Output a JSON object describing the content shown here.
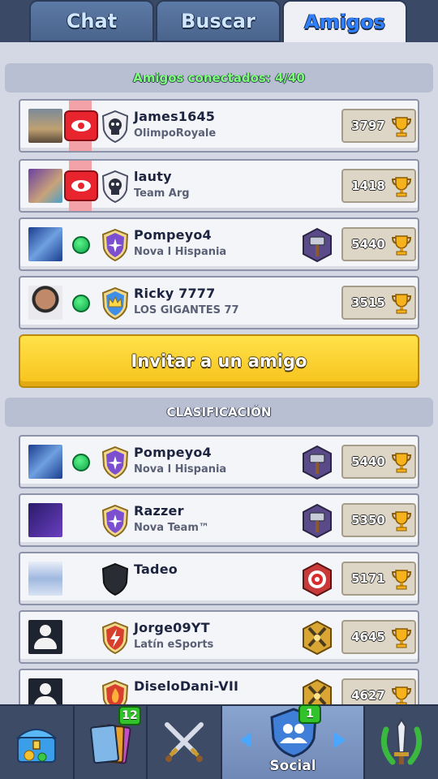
{
  "tabs": [
    {
      "label": "Chat"
    },
    {
      "label": "Buscar"
    },
    {
      "label": "Amigos"
    }
  ],
  "friends": {
    "header": "Amigos conectados: 4/40",
    "rows": [
      {
        "name": "James1645",
        "clan": "OlimpoRoyale",
        "trophies": "3797"
      },
      {
        "name": "lauty",
        "clan": "Team Arg",
        "trophies": "1418"
      },
      {
        "name": "Pompeyo4",
        "clan": "Nova l Hispania",
        "trophies": "5440"
      },
      {
        "name": "Ricky 7777",
        "clan": "LOS GIGANTES 77",
        "trophies": "3515"
      }
    ]
  },
  "invite_button": "Invitar a un amigo",
  "ranking": {
    "header": "CLASIFICACIÓN",
    "rows": [
      {
        "name": "Pompeyo4",
        "clan": "Nova l Hispania",
        "trophies": "5440"
      },
      {
        "name": "Razzer",
        "clan": "Nova Team™",
        "trophies": "5350"
      },
      {
        "name": "Tadeo",
        "clan": "",
        "trophies": "5171"
      },
      {
        "name": "Jorge09YT",
        "clan": "Latín eSports",
        "trophies": "4645"
      },
      {
        "name": "DiseloDani-VII",
        "clan": "",
        "trophies": "4627"
      }
    ]
  },
  "bottom_nav": {
    "cards_badge": "12",
    "social_badge": "1",
    "social_label": "Social"
  },
  "colors": {
    "watching": "#e8242e",
    "online": "#1ec25a",
    "invite": "#f6c21a"
  }
}
